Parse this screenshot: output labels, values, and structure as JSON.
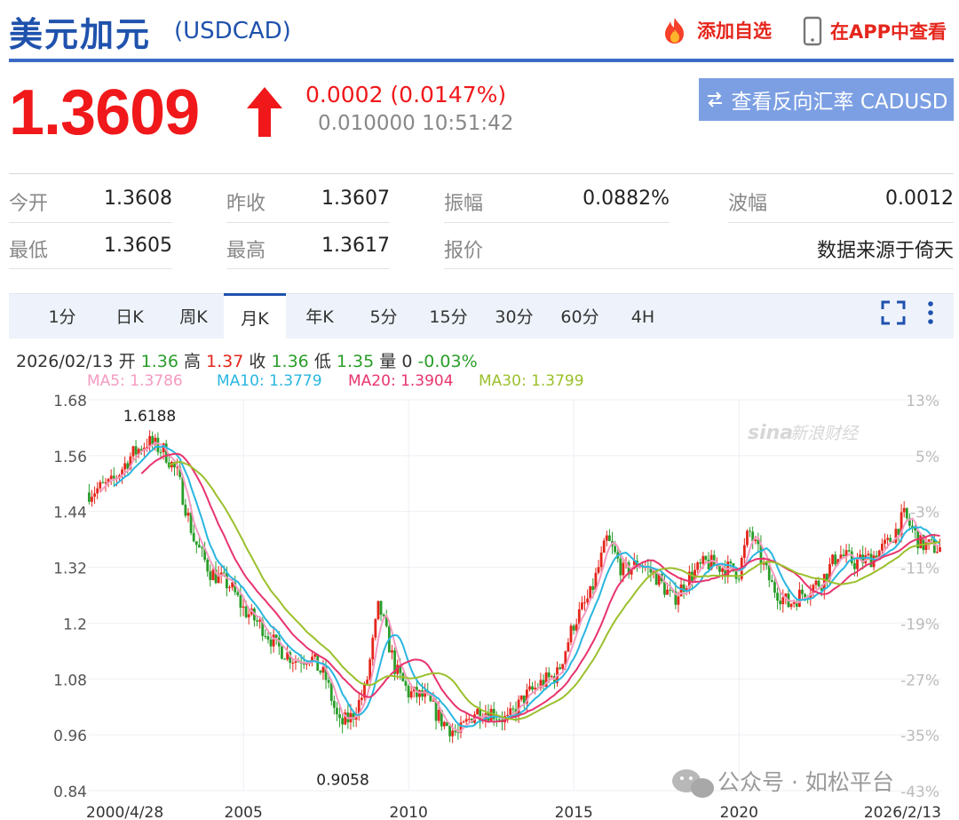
{
  "header": {
    "title": "美元加元",
    "code": "(USDCAD)",
    "add_watch": "添加自选",
    "app_view": "在APP中查看"
  },
  "quote": {
    "price": "1.3609",
    "change": "0.0002 (0.0147%)",
    "sub_value": "0.010000",
    "time": "10:51:42",
    "reverse_button": "查看反向汇率 CADUSD"
  },
  "stats": {
    "row1": [
      {
        "label": "今开",
        "value": "1.3608"
      },
      {
        "label": "昨收",
        "value": "1.3607"
      },
      {
        "label": "振幅",
        "value": "0.0882%"
      },
      {
        "label": "波幅",
        "value": "0.0012"
      }
    ],
    "row2": [
      {
        "label": "最低",
        "value": "1.3605"
      },
      {
        "label": "最高",
        "value": "1.3617"
      },
      {
        "label": "报价",
        "value": ""
      },
      {
        "label": "",
        "value": "数据来源于倚天"
      }
    ]
  },
  "tabs": [
    "1分",
    "日K",
    "周K",
    "月K",
    "年K",
    "5分",
    "15分",
    "30分",
    "60分",
    "4H"
  ],
  "active_tab": "月K",
  "info_bar": {
    "date": "2026/02/13",
    "open_label": "开",
    "open": "1.36",
    "high_label": "高",
    "high": "1.37",
    "close_label": "收",
    "close": "1.36",
    "low_label": "低",
    "low": "1.35",
    "vol_label": "量",
    "vol": "0",
    "pct": "-0.03%"
  },
  "ma": [
    {
      "name": "MA5",
      "value": "1.3786",
      "color": "#f49ac1"
    },
    {
      "name": "MA10",
      "value": "1.3779",
      "color": "#29b6e0"
    },
    {
      "name": "MA20",
      "value": "1.3904",
      "color": "#e8346d"
    },
    {
      "name": "MA30",
      "value": "1.3799",
      "color": "#9bc02c"
    }
  ],
  "colors": {
    "up": "#e5261c",
    "down": "#2a9d2a",
    "brand": "#1f52ad"
  },
  "watermark": {
    "brand": "新浪财经",
    "wechat": "公众号 · 如松平台"
  },
  "chart_data": {
    "type": "candlestick",
    "yticks": [
      "1.68",
      "1.56",
      "1.44",
      "1.32",
      "1.2",
      "1.08",
      "0.96",
      "0.84"
    ],
    "ylim": [
      0.84,
      1.68
    ],
    "pct_ticks": [
      "13%",
      "5%",
      "-3%",
      "-11%",
      "-19%",
      "-27%",
      "-35%",
      "-43%"
    ],
    "xticks": [
      "2000/4/28",
      "2005",
      "2010",
      "2015",
      "2020",
      "2026/2/13"
    ],
    "xlim": [
      2000.32,
      2026.12
    ],
    "annotations": [
      {
        "text": "1.6188",
        "x": 2002.0,
        "y": 1.6188
      },
      {
        "text": "0.9058",
        "x": 2007.9,
        "y": 0.9058
      }
    ],
    "series_path": [
      [
        2000.3,
        1.48
      ],
      [
        2001.0,
        1.5
      ],
      [
        2001.6,
        1.56
      ],
      [
        2002.1,
        1.59
      ],
      [
        2002.6,
        1.57
      ],
      [
        2003.0,
        1.52
      ],
      [
        2003.5,
        1.38
      ],
      [
        2004.0,
        1.31
      ],
      [
        2004.6,
        1.28
      ],
      [
        2005.0,
        1.23
      ],
      [
        2005.6,
        1.19
      ],
      [
        2006.0,
        1.15
      ],
      [
        2006.6,
        1.12
      ],
      [
        2007.0,
        1.13
      ],
      [
        2007.5,
        1.08
      ],
      [
        2007.9,
        0.98
      ],
      [
        2008.3,
        1.0
      ],
      [
        2008.7,
        1.06
      ],
      [
        2009.1,
        1.24
      ],
      [
        2009.6,
        1.1
      ],
      [
        2010.0,
        1.05
      ],
      [
        2010.5,
        1.04
      ],
      [
        2011.0,
        0.99
      ],
      [
        2011.5,
        0.96
      ],
      [
        2012.0,
        1.01
      ],
      [
        2012.5,
        1.01
      ],
      [
        2013.0,
        0.99
      ],
      [
        2013.5,
        1.04
      ],
      [
        2014.0,
        1.07
      ],
      [
        2014.5,
        1.09
      ],
      [
        2015.0,
        1.2
      ],
      [
        2015.5,
        1.26
      ],
      [
        2016.0,
        1.38
      ],
      [
        2016.5,
        1.31
      ],
      [
        2017.0,
        1.33
      ],
      [
        2017.5,
        1.3
      ],
      [
        2018.0,
        1.25
      ],
      [
        2018.5,
        1.3
      ],
      [
        2019.0,
        1.33
      ],
      [
        2019.5,
        1.32
      ],
      [
        2020.0,
        1.31
      ],
      [
        2020.3,
        1.4
      ],
      [
        2020.7,
        1.33
      ],
      [
        2021.0,
        1.28
      ],
      [
        2021.5,
        1.24
      ],
      [
        2022.0,
        1.27
      ],
      [
        2022.5,
        1.29
      ],
      [
        2023.0,
        1.35
      ],
      [
        2023.5,
        1.33
      ],
      [
        2024.0,
        1.34
      ],
      [
        2024.5,
        1.37
      ],
      [
        2025.0,
        1.43
      ],
      [
        2025.5,
        1.37
      ],
      [
        2026.1,
        1.36
      ]
    ]
  }
}
